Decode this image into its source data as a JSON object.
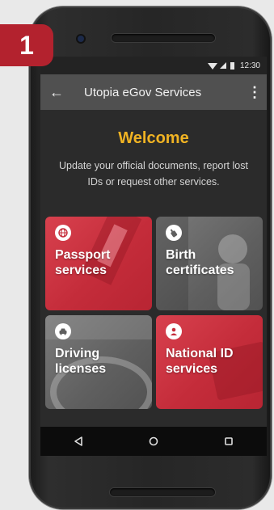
{
  "step_badge": {
    "label": "1",
    "color": "#b3222e"
  },
  "status_bar": {
    "time": "12:30",
    "icons": [
      "wifi-icon",
      "signal-icon",
      "battery-icon"
    ]
  },
  "app_bar": {
    "title": "Utopia eGov Services",
    "back_icon": "arrow-left-icon",
    "back_glyph": "←",
    "menu_icon": "more-vert-icon",
    "menu_glyph": "⋮"
  },
  "welcome": {
    "title": "Welcome",
    "text": "Update your official documents, report lost IDs or request other services.",
    "title_color": "#f0b323"
  },
  "tiles": [
    {
      "line1": "Passport",
      "line2": "services",
      "icon": "globe-icon",
      "style": "red"
    },
    {
      "line1": "Birth",
      "line2": "certificates",
      "icon": "baby-bottle-icon",
      "style": "gray"
    },
    {
      "line1": "Driving",
      "line2": "licenses",
      "icon": "car-icon",
      "style": "gray"
    },
    {
      "line1": "National ID",
      "line2": "services",
      "icon": "person-icon",
      "style": "red"
    }
  ],
  "nav_bar": {
    "back": "triangle-back-icon",
    "home": "circle-home-icon",
    "recents": "square-recents-icon"
  },
  "colors": {
    "accent_red": "#c42c3a",
    "tile_gray": "#5f5f5f",
    "screen_bg": "#2b2b2b",
    "app_bar_bg": "#505050"
  }
}
